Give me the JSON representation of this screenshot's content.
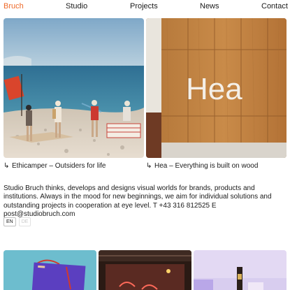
{
  "nav": {
    "brand": "Bruch",
    "links": [
      "Studio",
      "Projects",
      "News",
      "Contact"
    ]
  },
  "projects": [
    {
      "title": "Ethicamper – Outsiders for life",
      "arrow": "↳"
    },
    {
      "title": "Hea – Everything is built on wood",
      "arrow": "↳",
      "image_text": "Hea"
    }
  ],
  "intro": "Studio Bruch thinks, develops and designs visual worlds for brands, products and institutions. Always in the mood for new beginnings, we aim for individual solutions and outstanding projects in cooperation at eye level. T +43 316 812525 E post@studiobruch.com",
  "languages": [
    {
      "label": "EN",
      "active": true
    },
    {
      "label": "DE",
      "active": false
    }
  ],
  "colors": {
    "accent": "#ee6a2a",
    "text": "#1a1a1a",
    "background": "#ffffff"
  }
}
